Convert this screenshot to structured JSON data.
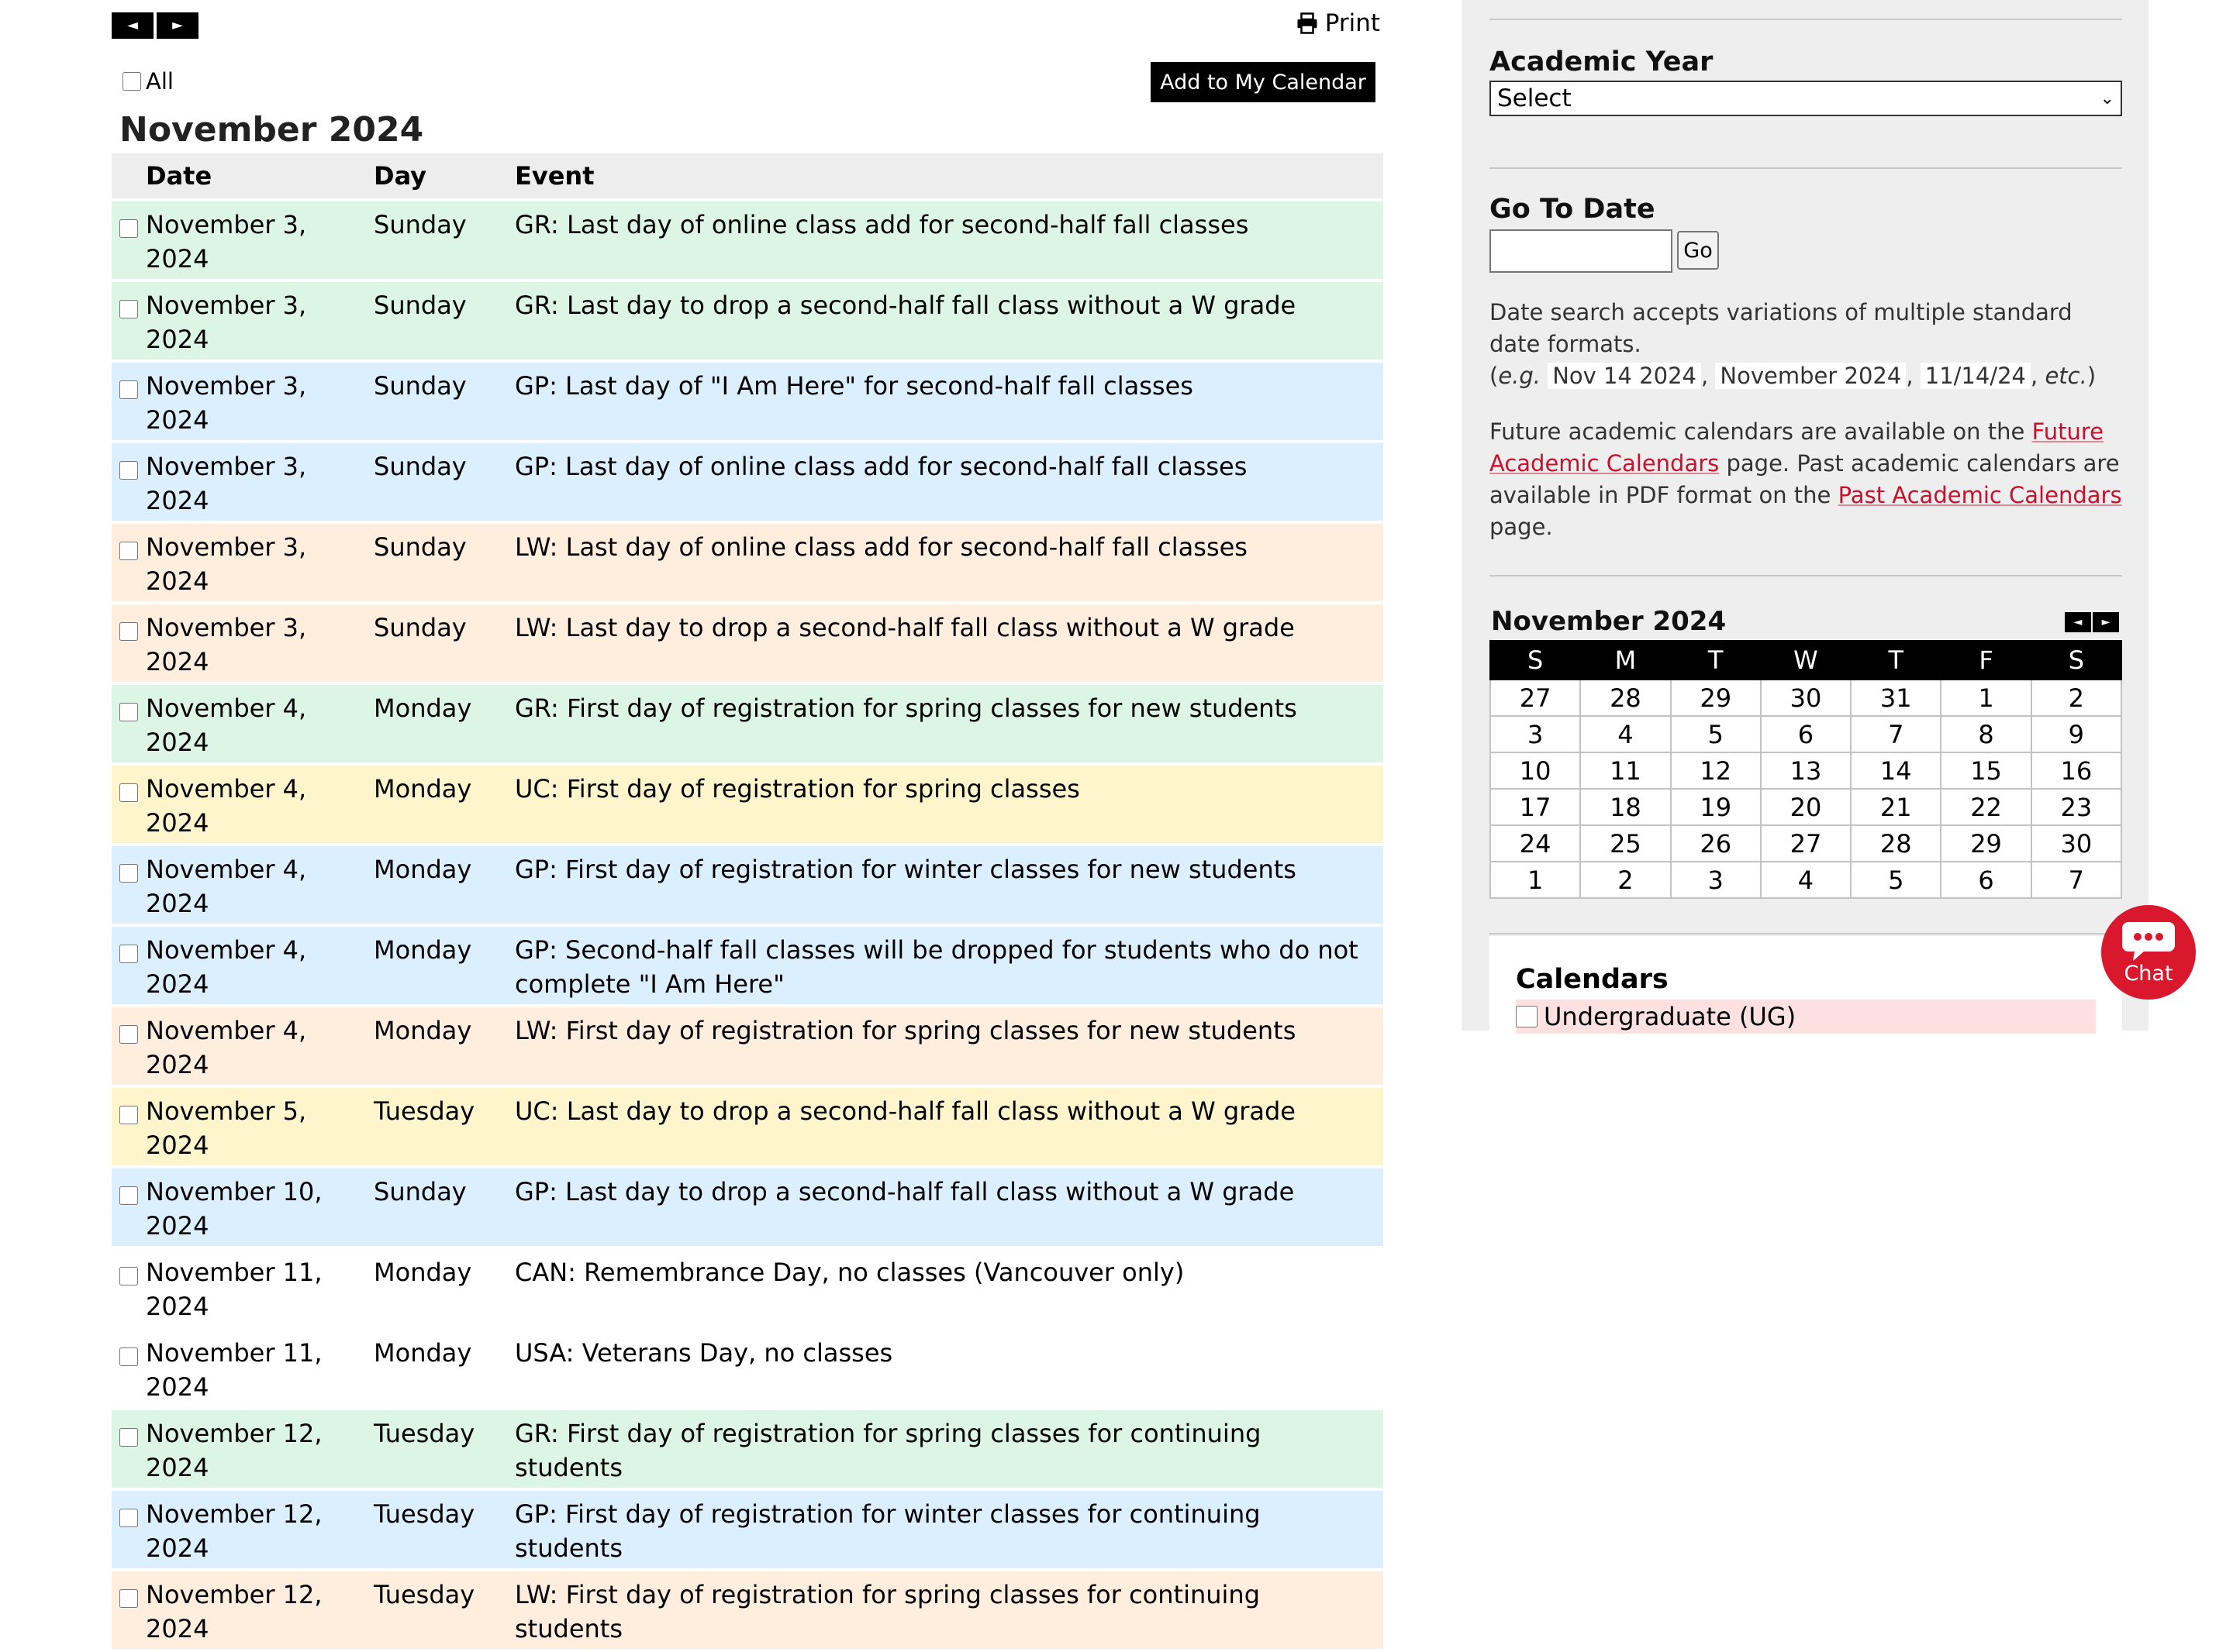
{
  "toolbar": {
    "prev_icon": "◄",
    "next_icon": "►",
    "print_label": "Print",
    "all_label": "All",
    "add_button": "Add to My Calendar"
  },
  "month_title": "November 2024",
  "table": {
    "headers": {
      "date": "Date",
      "day": "Day",
      "event": "Event"
    },
    "rows": [
      {
        "date": "November 3, 2024",
        "day": "Sunday",
        "event": "GR: Last day of online class add for second-half fall classes",
        "cat": "GR"
      },
      {
        "date": "November 3, 2024",
        "day": "Sunday",
        "event": "GR: Last day to drop a second-half fall class without a W grade",
        "cat": "GR"
      },
      {
        "date": "November 3, 2024",
        "day": "Sunday",
        "event": "GP: Last day of \"I Am Here\" for second-half fall classes",
        "cat": "GP"
      },
      {
        "date": "November 3, 2024",
        "day": "Sunday",
        "event": "GP: Last day of online class add for second-half fall classes",
        "cat": "GP"
      },
      {
        "date": "November 3, 2024",
        "day": "Sunday",
        "event": "LW: Last day of online class add for second-half fall classes",
        "cat": "LW"
      },
      {
        "date": "November 3, 2024",
        "day": "Sunday",
        "event": "LW: Last day to drop a second-half fall class without a W grade",
        "cat": "LW"
      },
      {
        "date": "November 4, 2024",
        "day": "Monday",
        "event": "GR: First day of registration for spring classes for new students",
        "cat": "GR"
      },
      {
        "date": "November 4, 2024",
        "day": "Monday",
        "event": "UC: First day of registration for spring classes",
        "cat": "UC"
      },
      {
        "date": "November 4, 2024",
        "day": "Monday",
        "event": "GP: First day of registration for winter classes for new students",
        "cat": "GP"
      },
      {
        "date": "November 4, 2024",
        "day": "Monday",
        "event": "GP: Second-half fall classes will be dropped for students who do not complete \"I Am Here\"",
        "cat": "GP"
      },
      {
        "date": "November 4, 2024",
        "day": "Monday",
        "event": "LW: First day of registration for spring classes for new students",
        "cat": "LW"
      },
      {
        "date": "November 5, 2024",
        "day": "Tuesday",
        "event": "UC: Last day to drop a second-half fall class without a W grade",
        "cat": "UC"
      },
      {
        "date": "November 10, 2024",
        "day": "Sunday",
        "event": "GP: Last day to drop a second-half fall class without a W grade",
        "cat": "GP"
      },
      {
        "date": "November 11, 2024",
        "day": "Monday",
        "event": "CAN: Remembrance Day, no classes (Vancouver only)",
        "cat": "NONE"
      },
      {
        "date": "November 11, 2024",
        "day": "Monday",
        "event": "USA: Veterans Day, no classes",
        "cat": "NONE"
      },
      {
        "date": "November 12, 2024",
        "day": "Tuesday",
        "event": "GR: First day of registration for spring classes for continuing students",
        "cat": "GR"
      },
      {
        "date": "November 12, 2024",
        "day": "Tuesday",
        "event": "GP: First day of registration for winter classes for continuing students",
        "cat": "GP"
      },
      {
        "date": "November 12, 2024",
        "day": "Tuesday",
        "event": "LW: First day of registration for spring classes for continuing students",
        "cat": "LW"
      }
    ]
  },
  "category_colors": {
    "GR": "#ddf5e4",
    "GP": "#dcefff",
    "LW": "#ffeedd",
    "UC": "#fff5cc",
    "NONE": "#ffffff"
  },
  "sidebar": {
    "academic_year": {
      "heading": "Academic Year",
      "selected": "Select"
    },
    "go_to_date": {
      "heading": "Go To Date",
      "input_value": "",
      "button": "Go"
    },
    "date_help": {
      "line1": "Date search accepts variations of multiple standard date formats.",
      "open": "(",
      "eg": "e.g.",
      "formats": [
        "Nov 14 2024",
        "November 2024",
        "11/14/24"
      ],
      "etc": "etc.",
      "close": ")"
    },
    "links_text": {
      "part1": "Future academic calendars are available on the ",
      "future_link": "Future Academic Calendars",
      "part2": " page. Past academic calendars are available in PDF format on the ",
      "past_link": "Past Academic Calendars",
      "part3": " page."
    },
    "mini_calendar": {
      "title": "November 2024",
      "prev_icon": "◄",
      "next_icon": "►",
      "weekdays": [
        "S",
        "M",
        "T",
        "W",
        "T",
        "F",
        "S"
      ],
      "weeks": [
        [
          "27",
          "28",
          "29",
          "30",
          "31",
          "1",
          "2"
        ],
        [
          "3",
          "4",
          "5",
          "6",
          "7",
          "8",
          "9"
        ],
        [
          "10",
          "11",
          "12",
          "13",
          "14",
          "15",
          "16"
        ],
        [
          "17",
          "18",
          "19",
          "20",
          "21",
          "22",
          "23"
        ],
        [
          "24",
          "25",
          "26",
          "27",
          "28",
          "29",
          "30"
        ],
        [
          "1",
          "2",
          "3",
          "4",
          "5",
          "6",
          "7"
        ]
      ]
    },
    "calendars": {
      "heading": "Calendars",
      "first_item": "Undergraduate (UG)"
    }
  },
  "chat": {
    "label": "Chat",
    "icon": "chat-bubble-icon"
  },
  "colors": {
    "accent": "#c8102e",
    "chat": "#d9182d",
    "sidebar_bg": "#eeeeee"
  }
}
